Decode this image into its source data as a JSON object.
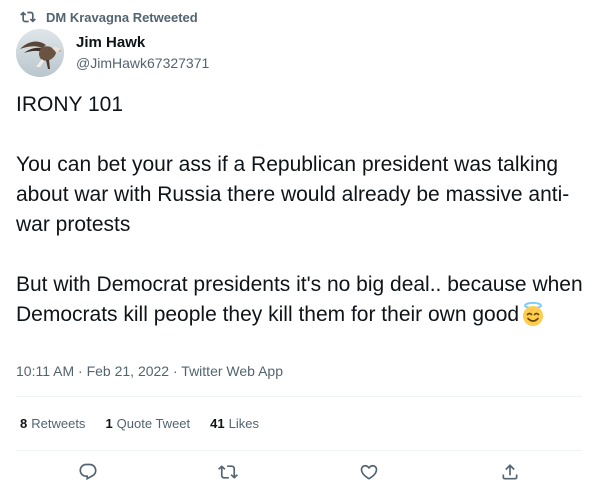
{
  "retweet_context": {
    "label": "DM Kravagna Retweeted",
    "icon": "retweet-icon"
  },
  "author": {
    "display_name": "Jim Hawk",
    "handle": "@JimHawk67327371",
    "avatar": "hawk-avatar"
  },
  "tweet": {
    "paragraphs": [
      "IRONY 101",
      "You can bet your ass if a Republican president was talking about war with Russia there would already be massive anti-war protests",
      "But with Democrat presidents it's no big deal.. because when Democrats kill people they kill them for their own good"
    ],
    "emoji": "smiling-face-with-halo"
  },
  "meta": {
    "time": "10:11 AM",
    "separator": "·",
    "date": "Feb 21, 2022",
    "source": "Twitter Web App"
  },
  "stats": {
    "retweets_count": "8",
    "retweets_label": "Retweets",
    "quotes_count": "1",
    "quotes_label": "Quote Tweet",
    "likes_count": "41",
    "likes_label": "Likes"
  },
  "actions": [
    "reply-icon",
    "retweet-icon",
    "like-icon",
    "share-icon"
  ],
  "colors": {
    "text_primary": "#0f1419",
    "text_secondary": "#536471",
    "divider": "#eff3f4"
  }
}
